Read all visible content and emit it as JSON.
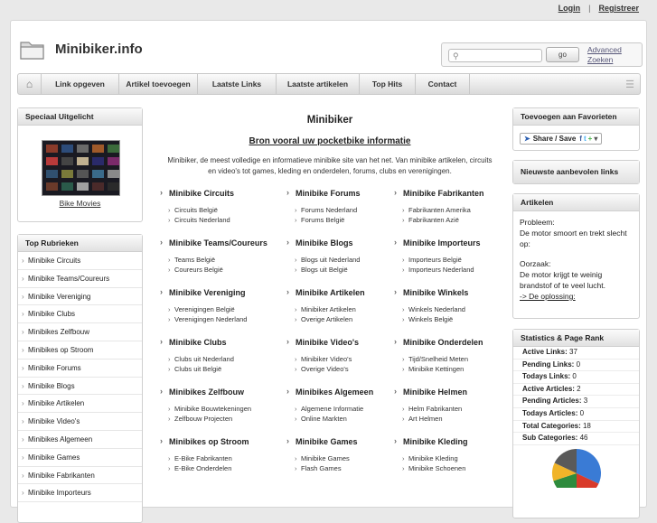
{
  "toplinks": {
    "login": "Login",
    "sep": "|",
    "register": "Registreer"
  },
  "site": {
    "title": "Minibiker.info"
  },
  "search": {
    "go": "go",
    "advanced": "Advanced Zoeken"
  },
  "nav": {
    "items": [
      "Link opgeven",
      "Artikel toevoegen",
      "Laatste Links",
      "Laatste artikelen",
      "Top Hits",
      "Contact"
    ]
  },
  "left": {
    "special_title": "Speciaal Uitgelicht",
    "special_caption": "Bike Movies",
    "top_title": "Top Rubrieken",
    "top_items": [
      "Minibike Circuits",
      "Minibike Teams/Coureurs",
      "Minibike Vereniging",
      "Minibike Clubs",
      "Minibikes Zelfbouw",
      "Minibikes op Stroom",
      "Minibike Forums",
      "Minibike Blogs",
      "Minibike Artikelen",
      "Minibike Video's",
      "Minibikes Algemeen",
      "Minibike Games",
      "Minibike Fabrikanten",
      "Minibike Importeurs"
    ]
  },
  "main": {
    "title": "Minibiker",
    "subtitle": "Bron vooral uw pocketbike informatie",
    "desc": "Minibiker, de meest volledige en informatieve minibike site van het net. Van minibike artikelen, circuits en video's tot games, kleding en onderdelen, forums, clubs en verenigingen.",
    "categories": [
      {
        "title": "Minibike Circuits",
        "subs": [
          "Circuits België",
          "Circuits Nederland"
        ]
      },
      {
        "title": "Minibike Forums",
        "subs": [
          "Forums Nederland",
          "Forums België"
        ]
      },
      {
        "title": "Minibike Fabrikanten",
        "subs": [
          "Fabrikanten Amerika",
          "Fabrikanten Azië"
        ]
      },
      {
        "title": "Minibike Teams/Coureurs",
        "subs": [
          "Teams België",
          "Coureurs België"
        ]
      },
      {
        "title": "Minibike Blogs",
        "subs": [
          "Blogs uit Nederland",
          "Blogs uit België"
        ]
      },
      {
        "title": "Minibike Importeurs",
        "subs": [
          "Importeurs België",
          "Importeurs Nederland"
        ]
      },
      {
        "title": "Minibike Vereniging",
        "subs": [
          "Verenigingen België",
          "Verenigingen Nederland"
        ]
      },
      {
        "title": "Minibike Artikelen",
        "subs": [
          "Minibiker Artikelen",
          "Overige Artikelen"
        ]
      },
      {
        "title": "Minibike Winkels",
        "subs": [
          "Winkels Nederland",
          "Winkels België"
        ]
      },
      {
        "title": "Minibike Clubs",
        "subs": [
          "Clubs uit Nederland",
          "Clubs uit België"
        ]
      },
      {
        "title": "Minibike Video's",
        "subs": [
          "Minibiker Video's",
          "Overige Video's"
        ]
      },
      {
        "title": "Minibike Onderdelen",
        "subs": [
          "Tijd/Snelheid Meten",
          "Minibike Kettingen"
        ]
      },
      {
        "title": "Minibikes Zelfbouw",
        "subs": [
          "Minibike Bouwtekeningen",
          "Zelfbouw Projecten"
        ]
      },
      {
        "title": "Minibikes Algemeen",
        "subs": [
          "Algemene Informatie",
          "Online Markten"
        ]
      },
      {
        "title": "Minibike Helmen",
        "subs": [
          "Helm Fabrikanten",
          "Art Helmen"
        ]
      },
      {
        "title": "Minibikes op Stroom",
        "subs": [
          "E-Bike Fabrikanten",
          "E-Bike Onderdelen"
        ]
      },
      {
        "title": "Minibike Games",
        "subs": [
          "Minibike Games",
          "Flash Games"
        ]
      },
      {
        "title": "Minibike Kleding",
        "subs": [
          "Minibike Kleding",
          "Minibike Schoenen"
        ]
      }
    ]
  },
  "right": {
    "fav_title": "Toevoegen aan Favorieten",
    "share": "Share / Save",
    "newest_title": "Nieuwste aanbevolen links",
    "art_title": "Artikelen",
    "art_p1_label": "Probleem:",
    "art_p1": "De motor smoort en trekt slecht op:",
    "art_p2_label": "Oorzaak:",
    "art_p2": "De motor krijgt te weinig brandstof of te veel lucht.",
    "art_link": "-> De oplossing:",
    "stats_title": "Statistics & Page Rank",
    "stats": [
      {
        "label": "Active Links:",
        "value": "37"
      },
      {
        "label": "Pending Links:",
        "value": "0"
      },
      {
        "label": "Todays Links:",
        "value": "0"
      },
      {
        "label": "Active Articles:",
        "value": "2"
      },
      {
        "label": "Pending Articles:",
        "value": "3"
      },
      {
        "label": "Todays Articles:",
        "value": "0"
      },
      {
        "label": "Total Categories:",
        "value": "18"
      },
      {
        "label": "Sub Categories:",
        "value": "46"
      }
    ]
  },
  "colors": {
    "pie": [
      "#3a7bd5",
      "#d93a2a",
      "#2e8b3d",
      "#f0b429",
      "#5a5a5a"
    ]
  }
}
